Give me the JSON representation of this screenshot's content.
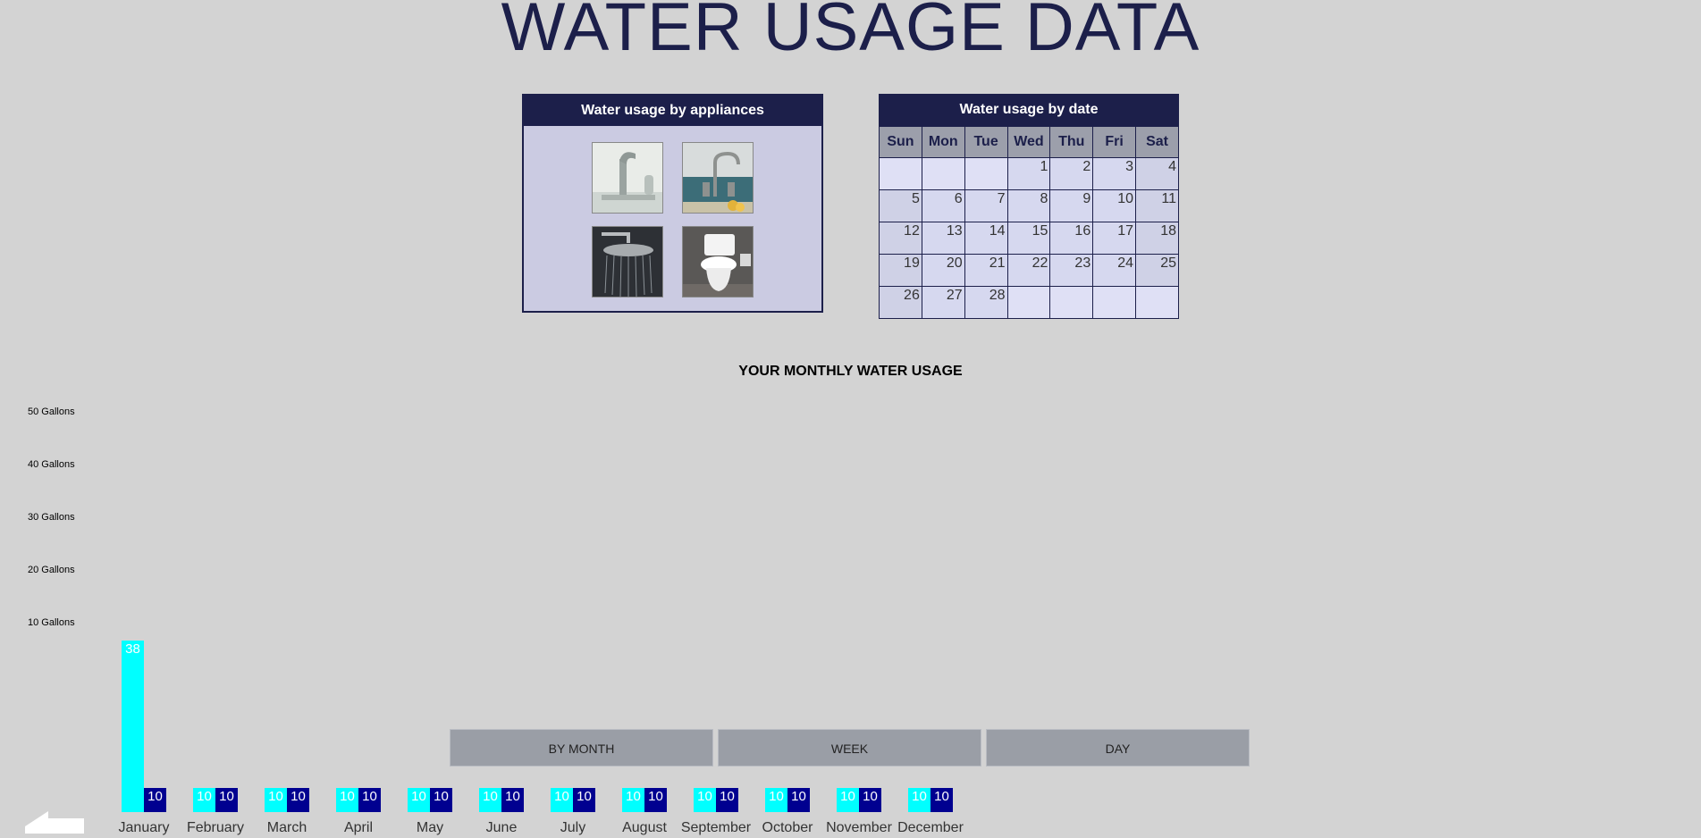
{
  "title": "WATER USAGE DATA",
  "appliances": {
    "header": "Water usage by appliances",
    "items": [
      {
        "icon": "bathroom-faucet-icon"
      },
      {
        "icon": "kitchen-faucet-icon"
      },
      {
        "icon": "showerhead-icon"
      },
      {
        "icon": "toilet-icon"
      }
    ]
  },
  "calendar": {
    "header": "Water usage by date",
    "days": [
      "Sun",
      "Mon",
      "Tue",
      "Wed",
      "Thu",
      "Fri",
      "Sat"
    ],
    "weeks": [
      [
        "",
        "",
        "",
        "1",
        "2",
        "3",
        "4"
      ],
      [
        "5",
        "6",
        "7",
        "8",
        "9",
        "10",
        "11"
      ],
      [
        "12",
        "13",
        "14",
        "15",
        "16",
        "17",
        "18"
      ],
      [
        "19",
        "20",
        "21",
        "22",
        "23",
        "24",
        "25"
      ],
      [
        "26",
        "27",
        "28",
        "",
        "",
        "",
        ""
      ]
    ]
  },
  "chart_data": {
    "type": "bar",
    "title": "YOUR MONTHLY WATER USAGE",
    "y_ticks": [
      "50 Gallons",
      "40 Gallons",
      "30 Gallons",
      "20 Gallons",
      "10 Gallons"
    ],
    "ylim": [
      0,
      50
    ],
    "categories": [
      "January",
      "February",
      "March",
      "April",
      "May",
      "June",
      "July",
      "August",
      "September",
      "October",
      "November",
      "December"
    ],
    "series": [
      {
        "color": "#00ffff",
        "values": [
          38,
          10,
          10,
          10,
          10,
          10,
          10,
          10,
          10,
          10,
          10,
          10
        ]
      },
      {
        "color": "#000090",
        "values": [
          10,
          10,
          10,
          10,
          10,
          10,
          10,
          10,
          10,
          10,
          10,
          10
        ]
      }
    ]
  },
  "view_buttons": [
    "BY MONTH",
    "WEEK",
    "DAY"
  ],
  "back": {
    "icon": "back-arrow-icon"
  }
}
